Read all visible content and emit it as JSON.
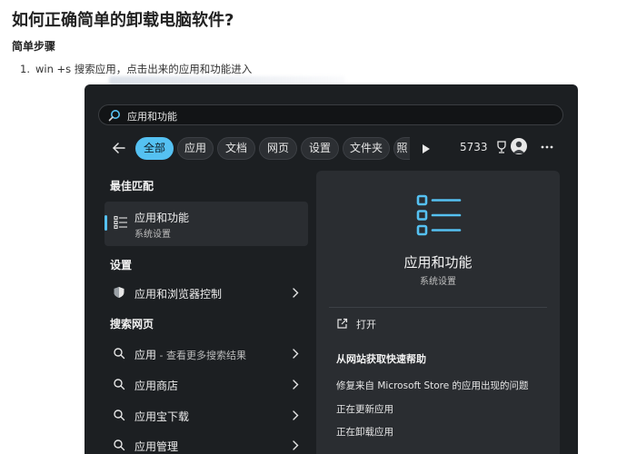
{
  "doc": {
    "title": "如何正确简单的卸载电脑软件?",
    "subtitle": "简单步骤",
    "step_number": "1.",
    "step_text": "win +s 搜索应用，点击出来的应用和功能进入"
  },
  "search": {
    "query": "应用和功能"
  },
  "filters": {
    "chips": [
      "全部",
      "应用",
      "文档",
      "网页",
      "设置",
      "文件夹",
      "照"
    ],
    "active": "全部",
    "points": "5733"
  },
  "results": {
    "best_match_header": "最佳匹配",
    "best_match": {
      "title": "应用和功能",
      "subtitle": "系统设置"
    },
    "settings_header": "设置",
    "settings_item": "应用和浏览器控制",
    "web_header": "搜索网页",
    "web_items": [
      {
        "main": "应用",
        "suffix": " - 查看更多搜索结果"
      },
      {
        "main": "应用商店",
        "suffix": ""
      },
      {
        "main": "应用宝下载",
        "suffix": ""
      },
      {
        "main": "应用管理",
        "suffix": ""
      }
    ]
  },
  "detail": {
    "title": "应用和功能",
    "subtitle": "系统设置",
    "open_label": "打开",
    "help_header": "从网站获取快速帮助",
    "help_links": [
      "修复来自 Microsoft Store 的应用出现的问题",
      "正在更新应用",
      "正在卸载应用"
    ]
  },
  "colors": {
    "accent": "#55c1f2",
    "window_bg": "#1c1f22",
    "panel_bg": "#2a2d31"
  }
}
